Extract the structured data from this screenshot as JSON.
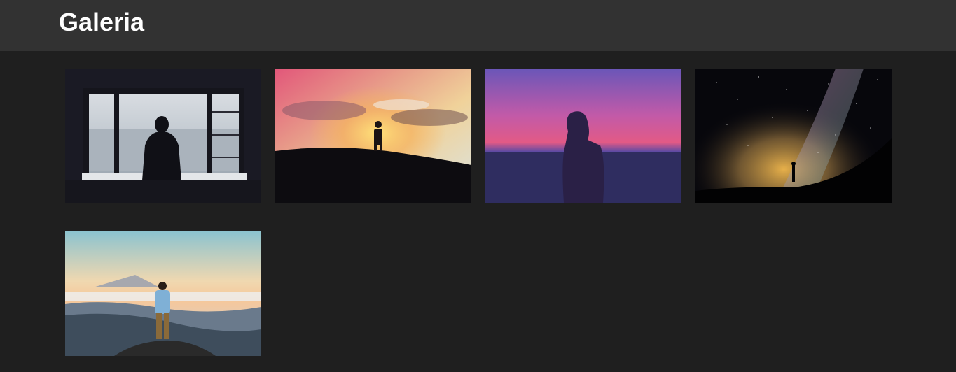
{
  "header": {
    "title": "Galeria"
  },
  "gallery": {
    "images": [
      {
        "alt": "silhouette-window"
      },
      {
        "alt": "silhouette-sunset-hill"
      },
      {
        "alt": "silhouette-woman-purple-sky"
      },
      {
        "alt": "silhouette-milky-way"
      },
      {
        "alt": "man-mountain-view"
      }
    ]
  },
  "colors": {
    "page_bg": "#1f1f1f",
    "header_bg": "#323232",
    "title": "#ffffff"
  }
}
